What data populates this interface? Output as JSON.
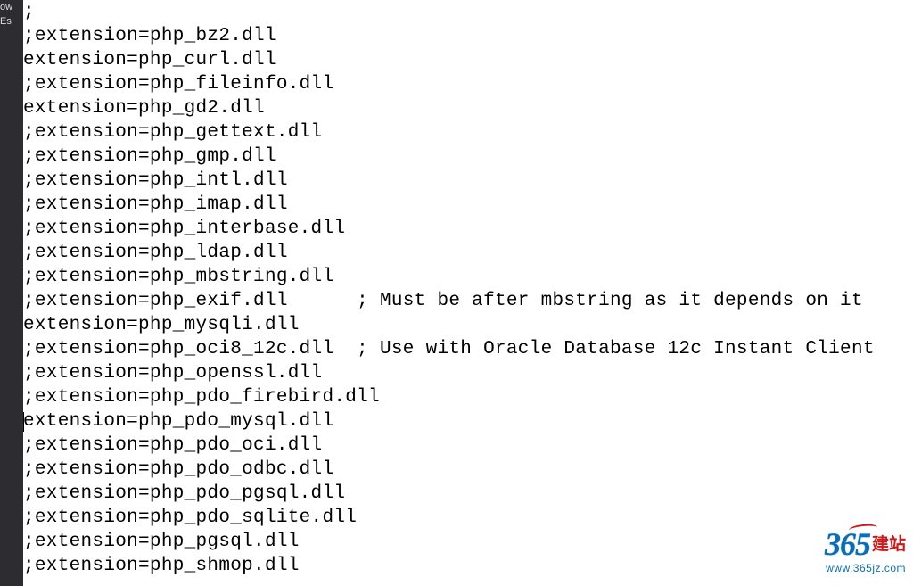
{
  "sidebar": {
    "line1": "ow",
    "line2": "Es"
  },
  "editor": {
    "lines": [
      ";",
      ";extension=php_bz2.dll",
      "extension=php_curl.dll",
      ";extension=php_fileinfo.dll",
      "extension=php_gd2.dll",
      ";extension=php_gettext.dll",
      ";extension=php_gmp.dll",
      ";extension=php_intl.dll",
      ";extension=php_imap.dll",
      ";extension=php_interbase.dll",
      ";extension=php_ldap.dll",
      ";extension=php_mbstring.dll",
      ";extension=php_exif.dll      ; Must be after mbstring as it depends on it",
      "extension=php_mysqli.dll",
      ";extension=php_oci8_12c.dll  ; Use with Oracle Database 12c Instant Client",
      ";extension=php_openssl.dll",
      ";extension=php_pdo_firebird.dll",
      "extension=php_pdo_mysql.dll",
      ";extension=php_pdo_oci.dll",
      ";extension=php_pdo_odbc.dll",
      ";extension=php_pdo_pgsql.dll",
      ";extension=php_pdo_sqlite.dll",
      ";extension=php_pgsql.dll",
      ";extension=php_shmop.dll"
    ],
    "cursor_line_index": 17
  },
  "watermark": {
    "number": "365",
    "cn": "建站",
    "url": "www.365jz.com"
  }
}
